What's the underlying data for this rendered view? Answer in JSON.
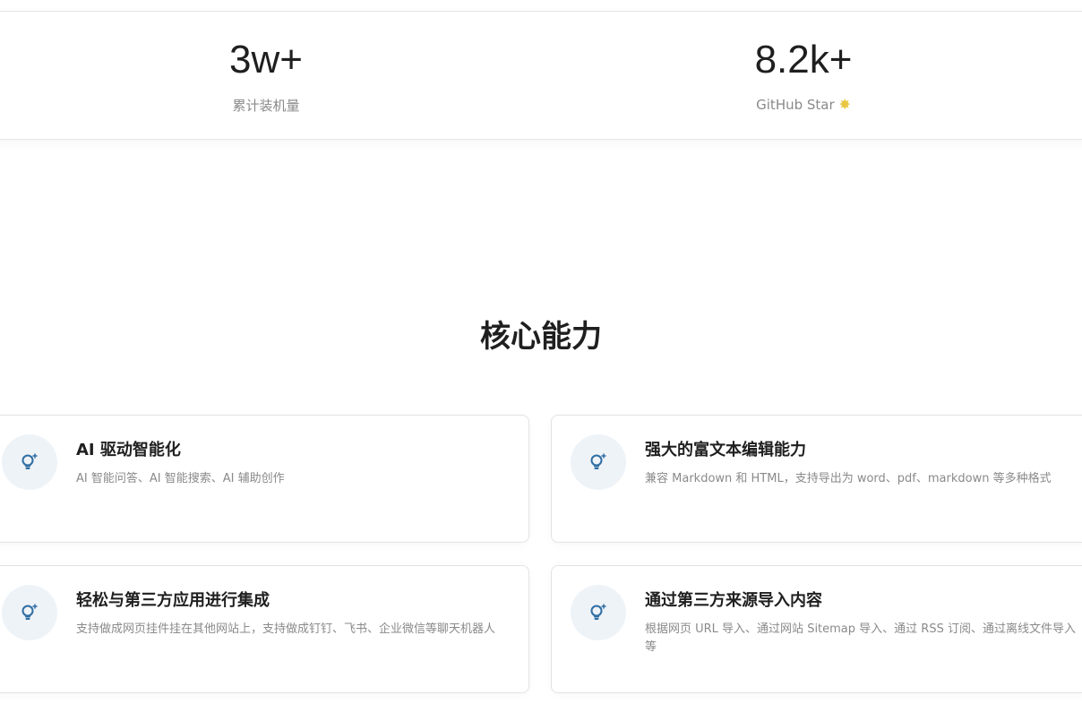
{
  "stats": [
    {
      "value": "3w+",
      "label": "累计装机量"
    },
    {
      "value": "8.2k+",
      "label": "GitHub Star"
    }
  ],
  "section_title": "核心能力",
  "features": [
    {
      "title": "AI 驱动智能化",
      "desc": "AI 智能问答、AI 智能搜索、AI 辅助创作",
      "icon": "lightbulb-sparkle-icon"
    },
    {
      "title": "强大的富文本编辑能力",
      "desc": "兼容 Markdown 和 HTML，支持导出为 word、pdf、markdown 等多种格式",
      "icon": "lightbulb-sparkle-icon"
    },
    {
      "title": "轻松与第三方应用进行集成",
      "desc": "支持做成网页挂件挂在其他网站上，支持做成钉钉、飞书、企业微信等聊天机器人",
      "icon": "lightbulb-sparkle-icon"
    },
    {
      "title": "通过第三方来源导入内容",
      "desc": "根据网页 URL 导入、通过网站 Sitemap 导入、通过 RSS 订阅、通过离线文件导入等",
      "icon": "lightbulb-sparkle-icon"
    }
  ],
  "colors": {
    "icon": "#2f6da3",
    "icon_bg": "#eef3f8"
  }
}
